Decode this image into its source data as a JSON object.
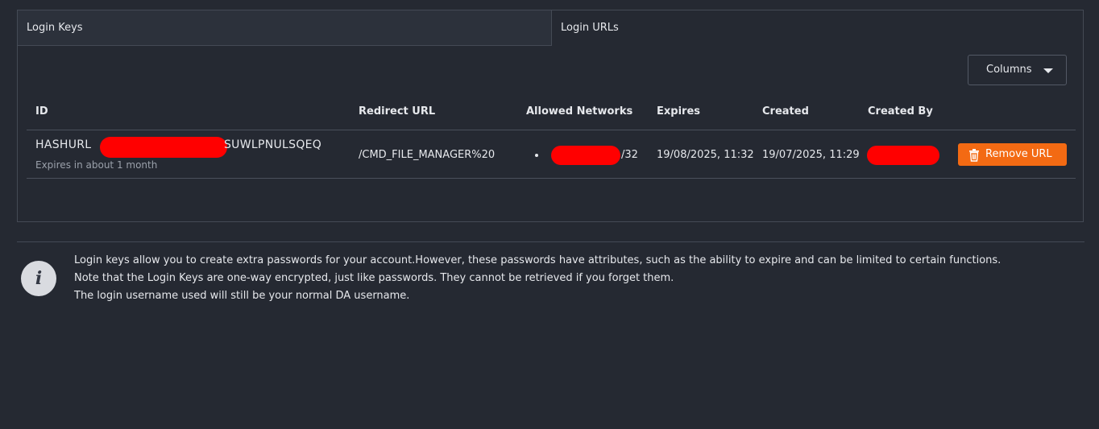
{
  "tabs": [
    {
      "label": "Login Keys"
    },
    {
      "label": "Login URLs"
    }
  ],
  "columns_button": {
    "label": "Columns"
  },
  "table": {
    "headers": [
      "ID",
      "Redirect URL",
      "Allowed Networks",
      "Expires",
      "Created",
      "Created By"
    ],
    "rows": [
      {
        "id_prefix": "HASHURL",
        "id_suffix": "SUWLPNULSQEQ",
        "id_note": "Expires in about 1 month",
        "redirect_url": "/CMD_FILE_MANAGER%20",
        "network_suffix": "/32",
        "expires": "19/08/2025, 11:32",
        "created": "19/07/2025, 11:29",
        "action_label": "Remove URL"
      }
    ]
  },
  "info": {
    "lines": [
      "Login keys allow you to create extra passwords for your account.However, these passwords have attributes, such as the ability to expire and can be limited to certain functions.",
      "Note that the Login Keys are one-way encrypted, just like passwords. They cannot be retrieved if you forget them.",
      "The login username used will still be your normal DA username."
    ]
  },
  "colors": {
    "background": "#252932",
    "accent": "#f36a13",
    "redaction": "#ff0000"
  },
  "icons": {
    "columns_caret": "chevron-down-icon",
    "remove": "trash-icon",
    "info": "info-icon"
  }
}
